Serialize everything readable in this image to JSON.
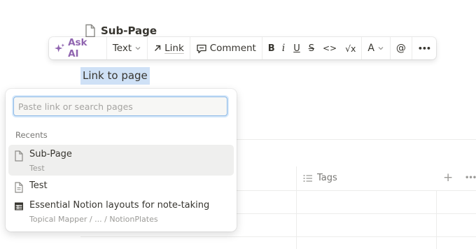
{
  "page": {
    "title": "Sub-Page",
    "selected_text": "Link to page"
  },
  "toolbar": {
    "ask_ai": "Ask AI",
    "text": "Text",
    "link": "Link",
    "comment": "Comment",
    "bold": "B",
    "italic": "i",
    "underline": "U",
    "strike": "S",
    "code": "<>",
    "math": "√x",
    "color": "A",
    "mention": "@",
    "more": "•••"
  },
  "popup": {
    "search_placeholder": "Paste link or search pages",
    "recents_label": "Recents",
    "items": [
      {
        "title": "Sub-Page",
        "subtitle": "Test",
        "icon": "page-icon"
      },
      {
        "title": "Test",
        "subtitle": "",
        "icon": "page-text-icon"
      },
      {
        "title": "Essential Notion layouts for note-taking",
        "subtitle": "Topical Mapper / ... / NotionPlates",
        "icon": "database-icon"
      }
    ]
  },
  "table": {
    "tags_header": "Tags",
    "add": "+",
    "more": "•••"
  }
}
